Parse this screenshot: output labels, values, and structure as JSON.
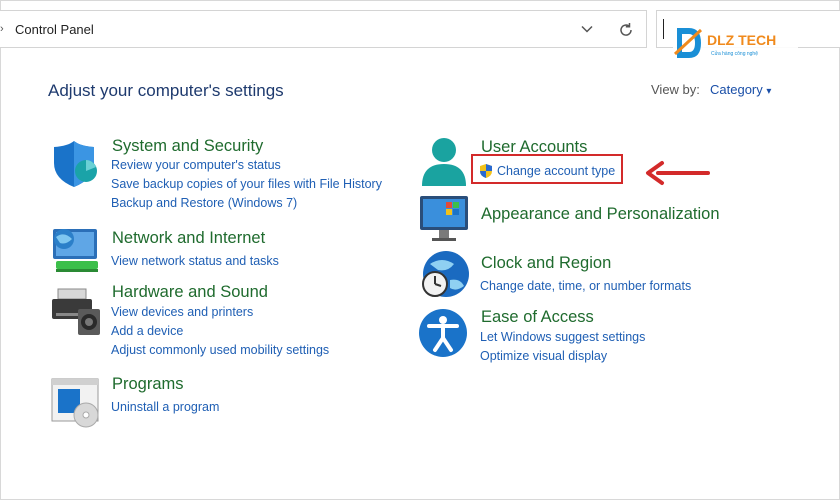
{
  "address_bar": {
    "crumb_arrow": "›",
    "path": "Control Panel"
  },
  "logo": {
    "brand": "DLZ TECH",
    "tagline": "Cửa hàng công nghệ"
  },
  "header": {
    "title": "Adjust your computer's settings",
    "view_by_label": "View by:",
    "view_by_value": "Category",
    "view_by_caret": "▾"
  },
  "categories": {
    "system_security": {
      "title": "System and Security",
      "links": [
        "Review your computer's status",
        "Save backup copies of your files with File History",
        "Backup and Restore (Windows 7)"
      ]
    },
    "network": {
      "title": "Network and Internet",
      "links": [
        "View network status and tasks"
      ]
    },
    "hardware": {
      "title": "Hardware and Sound",
      "links": [
        "View devices and printers",
        "Add a device",
        "Adjust commonly used mobility settings"
      ]
    },
    "programs": {
      "title": "Programs",
      "links": [
        "Uninstall a program"
      ]
    },
    "user_accounts": {
      "title": "User Accounts",
      "links": [
        "Change account type"
      ]
    },
    "appearance": {
      "title": "Appearance and Personalization",
      "links": []
    },
    "clock": {
      "title": "Clock and Region",
      "links": [
        "Change date, time, or number formats"
      ]
    },
    "ease": {
      "title": "Ease of Access",
      "links": [
        "Let Windows suggest settings",
        "Optimize visual display"
      ]
    }
  },
  "colors": {
    "title_green": "#1f6b2e",
    "link_blue": "#1f5fb4",
    "highlight_red": "#d32a2a"
  }
}
